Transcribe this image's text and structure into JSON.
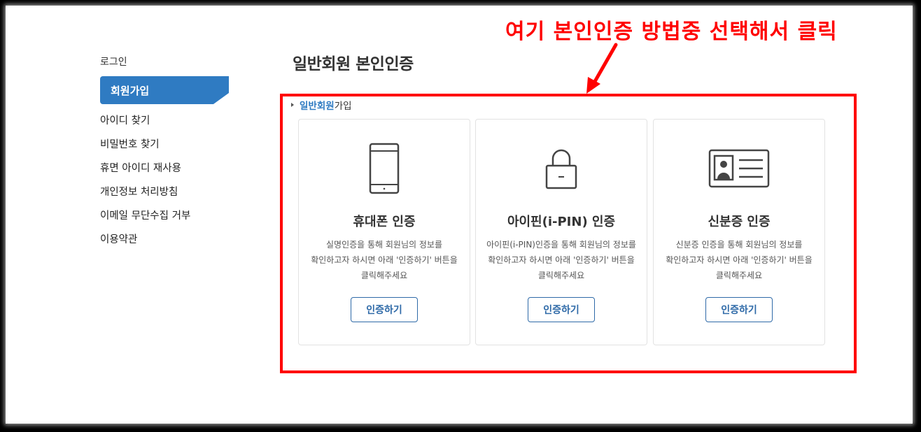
{
  "sidebar": {
    "title": "로그인",
    "active": "회원가입",
    "items": [
      {
        "label": "아이디 찾기"
      },
      {
        "label": "비밀번호 찾기"
      },
      {
        "label": "휴면 아이디 재사용"
      },
      {
        "label": "개인정보 처리방침"
      },
      {
        "label": "이메일 무단수집 거부"
      },
      {
        "label": "이용약관"
      }
    ]
  },
  "main": {
    "title": "일반회원 본인인증",
    "subtitle_highlight": "일반회원",
    "subtitle_rest": "가입",
    "annotation": "여기 본인인증 방법중 선택해서 클릭",
    "annotation_color": "#ff0000",
    "accent_color": "#2f7bc2",
    "cards": [
      {
        "icon": "phone-icon",
        "title": "휴대폰 인증",
        "desc_line1": "실명인증을 통해 회원님의 정보를",
        "desc_line2": "확인하고자 하시면 아래 '인증하기' 버튼을",
        "desc_line3": "클릭해주세요",
        "button": "인증하기"
      },
      {
        "icon": "lock-icon",
        "title": "아이핀(i-PIN) 인증",
        "desc_line1": "아이핀(i-PIN)인증을 통해 회원님의 정보를",
        "desc_line2": "확인하고자 하시면 아래 '인증하기' 버튼을",
        "desc_line3": "클릭해주세요",
        "button": "인증하기"
      },
      {
        "icon": "id-card-icon",
        "title": "신분증 인증",
        "desc_line1": "신분증 인증을 통해 회원님의 정보를",
        "desc_line2": "확인하고자 하시면 아래 '인증하기' 버튼을",
        "desc_line3": "클릭해주세요",
        "button": "인증하기"
      }
    ]
  }
}
